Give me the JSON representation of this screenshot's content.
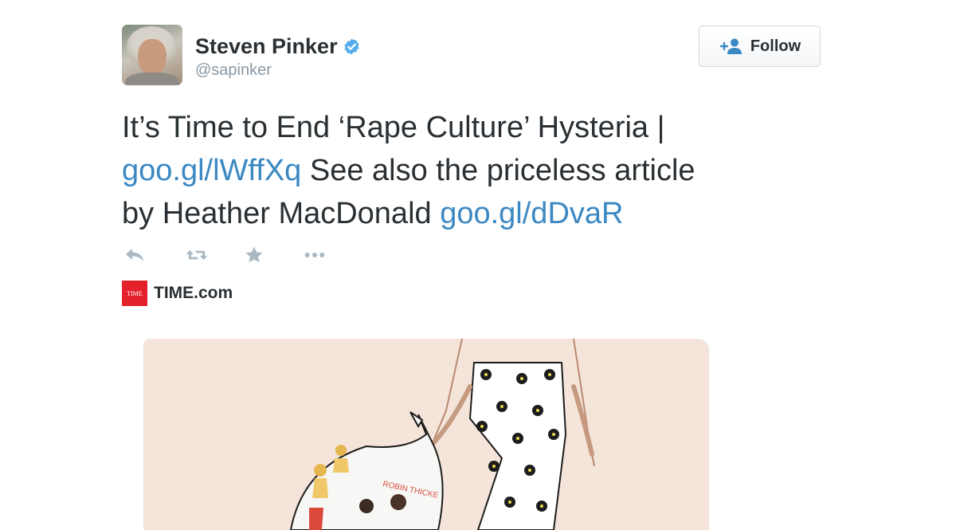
{
  "user": {
    "name": "Steven Pinker",
    "handle": "@sapinker"
  },
  "follow_button": {
    "label": "Follow"
  },
  "tweet": {
    "line1": "It’s Time to End ‘Rape Culture’ Hysteria |",
    "link1": "goo.gl/lWffXq",
    "line2_rest": " See also the priceless article",
    "line3_text": "by Heather MacDonald ",
    "link2": "goo.gl/dDvaR"
  },
  "actions": [
    "reply-icon",
    "retweet-icon",
    "favorite-icon",
    "more-icon"
  ],
  "source": {
    "logo_text": "TIME",
    "name": "TIME.com"
  },
  "card_image": {
    "bag_text": "ROBIN THICKE"
  },
  "colors": {
    "link": "#3b88c3",
    "verified": "#55acee",
    "text": "#292f33",
    "muted": "#8899a6",
    "time_red": "#e4202b",
    "card_bg": "#f5e4d9"
  }
}
